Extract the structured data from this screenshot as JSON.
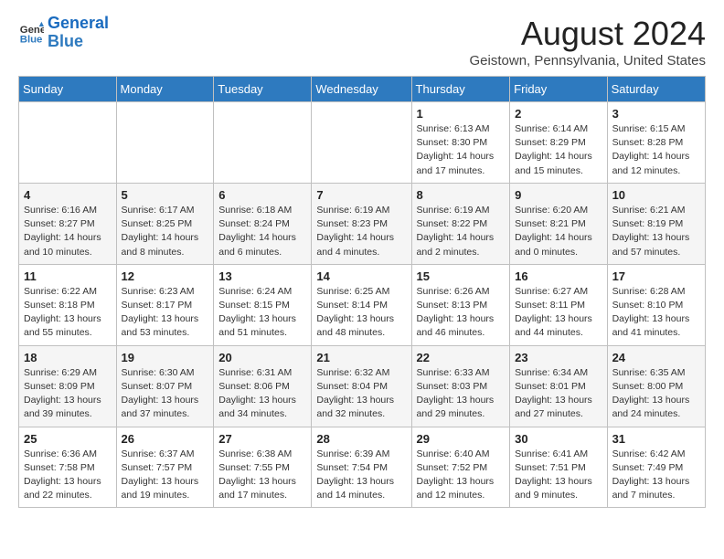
{
  "header": {
    "logo_line1": "General",
    "logo_line2": "Blue",
    "month_title": "August 2024",
    "location": "Geistown, Pennsylvania, United States"
  },
  "weekdays": [
    "Sunday",
    "Monday",
    "Tuesday",
    "Wednesday",
    "Thursday",
    "Friday",
    "Saturday"
  ],
  "weeks": [
    [
      {
        "day": "",
        "info": ""
      },
      {
        "day": "",
        "info": ""
      },
      {
        "day": "",
        "info": ""
      },
      {
        "day": "",
        "info": ""
      },
      {
        "day": "1",
        "info": "Sunrise: 6:13 AM\nSunset: 8:30 PM\nDaylight: 14 hours\nand 17 minutes."
      },
      {
        "day": "2",
        "info": "Sunrise: 6:14 AM\nSunset: 8:29 PM\nDaylight: 14 hours\nand 15 minutes."
      },
      {
        "day": "3",
        "info": "Sunrise: 6:15 AM\nSunset: 8:28 PM\nDaylight: 14 hours\nand 12 minutes."
      }
    ],
    [
      {
        "day": "4",
        "info": "Sunrise: 6:16 AM\nSunset: 8:27 PM\nDaylight: 14 hours\nand 10 minutes."
      },
      {
        "day": "5",
        "info": "Sunrise: 6:17 AM\nSunset: 8:25 PM\nDaylight: 14 hours\nand 8 minutes."
      },
      {
        "day": "6",
        "info": "Sunrise: 6:18 AM\nSunset: 8:24 PM\nDaylight: 14 hours\nand 6 minutes."
      },
      {
        "day": "7",
        "info": "Sunrise: 6:19 AM\nSunset: 8:23 PM\nDaylight: 14 hours\nand 4 minutes."
      },
      {
        "day": "8",
        "info": "Sunrise: 6:19 AM\nSunset: 8:22 PM\nDaylight: 14 hours\nand 2 minutes."
      },
      {
        "day": "9",
        "info": "Sunrise: 6:20 AM\nSunset: 8:21 PM\nDaylight: 14 hours\nand 0 minutes."
      },
      {
        "day": "10",
        "info": "Sunrise: 6:21 AM\nSunset: 8:19 PM\nDaylight: 13 hours\nand 57 minutes."
      }
    ],
    [
      {
        "day": "11",
        "info": "Sunrise: 6:22 AM\nSunset: 8:18 PM\nDaylight: 13 hours\nand 55 minutes."
      },
      {
        "day": "12",
        "info": "Sunrise: 6:23 AM\nSunset: 8:17 PM\nDaylight: 13 hours\nand 53 minutes."
      },
      {
        "day": "13",
        "info": "Sunrise: 6:24 AM\nSunset: 8:15 PM\nDaylight: 13 hours\nand 51 minutes."
      },
      {
        "day": "14",
        "info": "Sunrise: 6:25 AM\nSunset: 8:14 PM\nDaylight: 13 hours\nand 48 minutes."
      },
      {
        "day": "15",
        "info": "Sunrise: 6:26 AM\nSunset: 8:13 PM\nDaylight: 13 hours\nand 46 minutes."
      },
      {
        "day": "16",
        "info": "Sunrise: 6:27 AM\nSunset: 8:11 PM\nDaylight: 13 hours\nand 44 minutes."
      },
      {
        "day": "17",
        "info": "Sunrise: 6:28 AM\nSunset: 8:10 PM\nDaylight: 13 hours\nand 41 minutes."
      }
    ],
    [
      {
        "day": "18",
        "info": "Sunrise: 6:29 AM\nSunset: 8:09 PM\nDaylight: 13 hours\nand 39 minutes."
      },
      {
        "day": "19",
        "info": "Sunrise: 6:30 AM\nSunset: 8:07 PM\nDaylight: 13 hours\nand 37 minutes."
      },
      {
        "day": "20",
        "info": "Sunrise: 6:31 AM\nSunset: 8:06 PM\nDaylight: 13 hours\nand 34 minutes."
      },
      {
        "day": "21",
        "info": "Sunrise: 6:32 AM\nSunset: 8:04 PM\nDaylight: 13 hours\nand 32 minutes."
      },
      {
        "day": "22",
        "info": "Sunrise: 6:33 AM\nSunset: 8:03 PM\nDaylight: 13 hours\nand 29 minutes."
      },
      {
        "day": "23",
        "info": "Sunrise: 6:34 AM\nSunset: 8:01 PM\nDaylight: 13 hours\nand 27 minutes."
      },
      {
        "day": "24",
        "info": "Sunrise: 6:35 AM\nSunset: 8:00 PM\nDaylight: 13 hours\nand 24 minutes."
      }
    ],
    [
      {
        "day": "25",
        "info": "Sunrise: 6:36 AM\nSunset: 7:58 PM\nDaylight: 13 hours\nand 22 minutes."
      },
      {
        "day": "26",
        "info": "Sunrise: 6:37 AM\nSunset: 7:57 PM\nDaylight: 13 hours\nand 19 minutes."
      },
      {
        "day": "27",
        "info": "Sunrise: 6:38 AM\nSunset: 7:55 PM\nDaylight: 13 hours\nand 17 minutes."
      },
      {
        "day": "28",
        "info": "Sunrise: 6:39 AM\nSunset: 7:54 PM\nDaylight: 13 hours\nand 14 minutes."
      },
      {
        "day": "29",
        "info": "Sunrise: 6:40 AM\nSunset: 7:52 PM\nDaylight: 13 hours\nand 12 minutes."
      },
      {
        "day": "30",
        "info": "Sunrise: 6:41 AM\nSunset: 7:51 PM\nDaylight: 13 hours\nand 9 minutes."
      },
      {
        "day": "31",
        "info": "Sunrise: 6:42 AM\nSunset: 7:49 PM\nDaylight: 13 hours\nand 7 minutes."
      }
    ]
  ]
}
